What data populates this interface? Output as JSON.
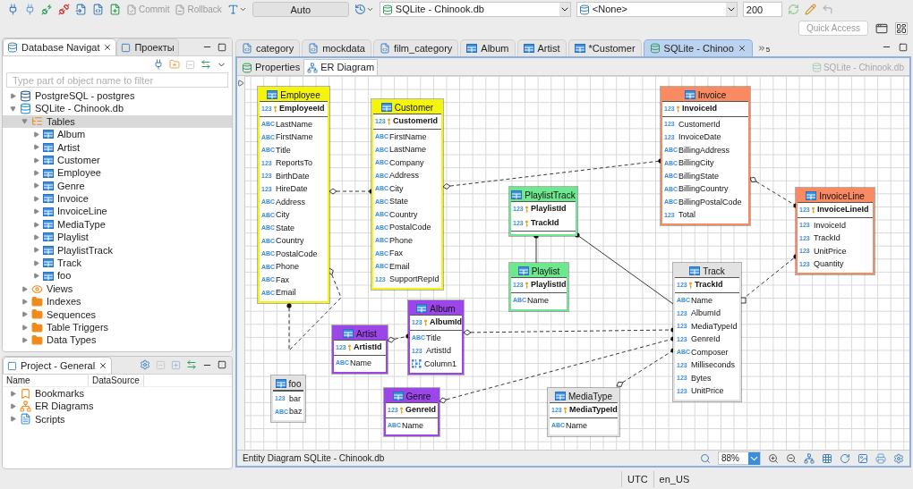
{
  "toolbar": {
    "commit": {
      "label": "Commit",
      "disabled": true
    },
    "rollback": {
      "label": "Rollback",
      "disabled": true
    },
    "transaction_mode": "Auto",
    "datasource": "SQLite - Chinook.db",
    "schema": "<None>",
    "result_limit": "200",
    "quick_access": {
      "placeholder": "Quick Access"
    }
  },
  "navigator": {
    "tabs": [
      {
        "label": "Database Navigat",
        "selected": true
      },
      {
        "label": "Проекты",
        "selected": false
      }
    ],
    "filter": {
      "placeholder": "Type part of object name to filter"
    },
    "tree": [
      {
        "label": "PostgreSQL - postgres",
        "kind": "postgres",
        "expanded": false,
        "selected": false
      },
      {
        "label": "SQLite - Chinook.db",
        "kind": "sqlite",
        "expanded": true,
        "selected": false,
        "children": [
          {
            "label": "Tables",
            "kind": "tables",
            "expanded": true,
            "selected": true,
            "children": [
              {
                "label": "Album",
                "kind": "table",
                "expanded": false,
                "selected": false
              },
              {
                "label": "Artist",
                "kind": "table",
                "expanded": false,
                "selected": false
              },
              {
                "label": "Customer",
                "kind": "table",
                "expanded": false,
                "selected": false
              },
              {
                "label": "Employee",
                "kind": "table",
                "expanded": false,
                "selected": false
              },
              {
                "label": "Genre",
                "kind": "table",
                "expanded": false,
                "selected": false
              },
              {
                "label": "Invoice",
                "kind": "table",
                "expanded": false,
                "selected": false
              },
              {
                "label": "InvoiceLine",
                "kind": "table",
                "expanded": false,
                "selected": false
              },
              {
                "label": "MediaType",
                "kind": "table",
                "expanded": false,
                "selected": false
              },
              {
                "label": "Playlist",
                "kind": "table",
                "expanded": false,
                "selected": false
              },
              {
                "label": "PlaylistTrack",
                "kind": "table",
                "expanded": false,
                "selected": false
              },
              {
                "label": "Track",
                "kind": "table",
                "expanded": false,
                "selected": false
              },
              {
                "label": "foo",
                "kind": "table",
                "expanded": false,
                "selected": false
              }
            ]
          },
          {
            "label": "Views",
            "kind": "views",
            "expanded": false,
            "selected": false
          },
          {
            "label": "Indexes",
            "kind": "folder",
            "expanded": false,
            "selected": false
          },
          {
            "label": "Sequences",
            "kind": "folder",
            "expanded": false,
            "selected": false
          },
          {
            "label": "Table Triggers",
            "kind": "folder",
            "expanded": false,
            "selected": false
          },
          {
            "label": "Data Types",
            "kind": "folder",
            "expanded": false,
            "selected": false
          }
        ]
      }
    ]
  },
  "project": {
    "title": "Project - General",
    "columns": [
      "Name",
      "DataSource"
    ],
    "items": [
      {
        "label": "Bookmarks",
        "kind": "bookmarks",
        "expanded": false
      },
      {
        "label": "ER Diagrams",
        "kind": "diagrams",
        "expanded": false
      },
      {
        "label": "Scripts",
        "kind": "scripts",
        "expanded": false
      }
    ]
  },
  "editor_tabs": [
    {
      "label": "category",
      "kind": "script",
      "selected": false
    },
    {
      "label": "mockdata",
      "kind": "script",
      "selected": false
    },
    {
      "label": "film_category",
      "kind": "script",
      "selected": false
    },
    {
      "label": "Album",
      "kind": "table",
      "selected": false
    },
    {
      "label": "Artist",
      "kind": "table",
      "selected": false
    },
    {
      "label": "*Customer",
      "kind": "table",
      "selected": false
    },
    {
      "label": "SQLite - Chinoo",
      "kind": "diagram",
      "selected": true
    }
  ],
  "hidden_tab_count": "5",
  "sub_tabs": [
    {
      "label": "Properties",
      "kind": "properties",
      "selected": false
    },
    {
      "label": "ER Diagram",
      "kind": "diagram",
      "selected": true
    }
  ],
  "object_label": "SQLite - Chinook.db",
  "diagram": {
    "entities": [
      {
        "name": "Employee",
        "color": "#f4f40c",
        "keys": [
          {
            "type": "123",
            "name": "EmployeeId"
          }
        ],
        "columns": [
          {
            "kind": "typed",
            "type": "ABC",
            "name": "LastName"
          },
          {
            "kind": "typed",
            "type": "ABC",
            "name": "FirstName"
          },
          {
            "kind": "typed",
            "type": "ABC",
            "name": "Title"
          },
          {
            "kind": "typed",
            "type": "123",
            "name": "ReportsTo"
          },
          {
            "kind": "typed",
            "type": "123",
            "name": "BirthDate"
          },
          {
            "kind": "typed",
            "type": "123",
            "name": "HireDate"
          },
          {
            "kind": "typed",
            "type": "ABC",
            "name": "Address"
          },
          {
            "kind": "typed",
            "type": "ABC",
            "name": "City"
          },
          {
            "kind": "typed",
            "type": "ABC",
            "name": "State"
          },
          {
            "kind": "typed",
            "type": "ABC",
            "name": "Country"
          },
          {
            "kind": "typed",
            "type": "ABC",
            "name": "PostalCode"
          },
          {
            "kind": "typed",
            "type": "ABC",
            "name": "Phone"
          },
          {
            "kind": "typed",
            "type": "ABC",
            "name": "Fax"
          },
          {
            "kind": "typed",
            "type": "ABC",
            "name": "Email"
          }
        ]
      },
      {
        "name": "Customer",
        "color": "#f4f40c",
        "keys": [
          {
            "type": "123",
            "name": "CustomerId"
          }
        ],
        "columns": [
          {
            "kind": "typed",
            "type": "ABC",
            "name": "FirstName"
          },
          {
            "kind": "typed",
            "type": "ABC",
            "name": "LastName"
          },
          {
            "kind": "typed",
            "type": "ABC",
            "name": "Company"
          },
          {
            "kind": "typed",
            "type": "ABC",
            "name": "Address"
          },
          {
            "kind": "typed",
            "type": "ABC",
            "name": "City"
          },
          {
            "kind": "typed",
            "type": "ABC",
            "name": "State"
          },
          {
            "kind": "typed",
            "type": "ABC",
            "name": "Country"
          },
          {
            "kind": "typed",
            "type": "ABC",
            "name": "PostalCode"
          },
          {
            "kind": "typed",
            "type": "ABC",
            "name": "Phone"
          },
          {
            "kind": "typed",
            "type": "ABC",
            "name": "Fax"
          },
          {
            "kind": "typed",
            "type": "ABC",
            "name": "Email"
          },
          {
            "kind": "typed",
            "type": "123",
            "name": "SupportRepId"
          }
        ]
      },
      {
        "name": "Invoice",
        "color": "#f98a62",
        "keys": [
          {
            "type": "123",
            "name": "InvoiceId"
          }
        ],
        "columns": [
          {
            "kind": "typed",
            "type": "123",
            "name": "CustomerId"
          },
          {
            "kind": "typed",
            "type": "123",
            "name": "InvoiceDate"
          },
          {
            "kind": "typed",
            "type": "ABC",
            "name": "BillingAddress"
          },
          {
            "kind": "typed",
            "type": "ABC",
            "name": "BillingCity"
          },
          {
            "kind": "typed",
            "type": "ABC",
            "name": "BillingState"
          },
          {
            "kind": "typed",
            "type": "ABC",
            "name": "BillingCountry"
          },
          {
            "kind": "typed",
            "type": "ABC",
            "name": "BillingPostalCode"
          },
          {
            "kind": "typed",
            "type": "123",
            "name": "Total"
          }
        ]
      },
      {
        "name": "PlaylistTrack",
        "color": "#6ee88e",
        "keys": [
          {
            "type": "123",
            "name": "PlaylistId"
          },
          {
            "type": "123",
            "name": "TrackId"
          }
        ]
      },
      {
        "name": "InvoiceLine",
        "color": "#f98a62",
        "keys": [
          {
            "type": "123",
            "name": "InvoiceLineId"
          }
        ],
        "columns": [
          {
            "kind": "typed",
            "type": "123",
            "name": "InvoiceId"
          },
          {
            "kind": "typed",
            "type": "123",
            "name": "TrackId"
          },
          {
            "kind": "typed",
            "type": "123",
            "name": "UnitPrice"
          },
          {
            "kind": "typed",
            "type": "123",
            "name": "Quantity"
          }
        ]
      },
      {
        "name": "Playlist",
        "color": "#6ee88e",
        "keys": [
          {
            "type": "123",
            "name": "PlaylistId"
          }
        ],
        "columns": [
          {
            "kind": "typed",
            "type": "ABC",
            "name": "Name"
          }
        ]
      },
      {
        "name": "Track",
        "color": "#e2e2e2",
        "keys": [
          {
            "type": "123",
            "name": "TrackId"
          }
        ],
        "columns": [
          {
            "kind": "typed",
            "type": "ABC",
            "name": "Name"
          },
          {
            "kind": "typed",
            "type": "123",
            "name": "AlbumId"
          },
          {
            "kind": "typed",
            "type": "123",
            "name": "MediaTypeId"
          },
          {
            "kind": "typed",
            "type": "123",
            "name": "GenreId"
          },
          {
            "kind": "typed",
            "type": "ABC",
            "name": "Composer"
          },
          {
            "kind": "typed",
            "type": "123",
            "name": "Milliseconds"
          },
          {
            "kind": "typed",
            "type": "123",
            "name": "Bytes"
          },
          {
            "kind": "typed",
            "type": "123",
            "name": "UnitPrice"
          }
        ]
      },
      {
        "name": "Artist",
        "color": "#9c45e8",
        "keys": [
          {
            "type": "123",
            "name": "ArtistId"
          }
        ],
        "columns": [
          {
            "kind": "typed",
            "type": "ABC",
            "name": "Name"
          }
        ]
      },
      {
        "name": "Album",
        "color": "#9c45e8",
        "keys": [
          {
            "type": "123",
            "name": "AlbumId"
          }
        ],
        "columns": [
          {
            "kind": "typed",
            "type": "ABC",
            "name": "Title"
          },
          {
            "kind": "typed",
            "type": "123",
            "name": "ArtistId"
          },
          {
            "kind": "binary",
            "name": "Column1"
          }
        ]
      },
      {
        "name": "foo",
        "color": "#e2e2e2",
        "columns": [
          {
            "kind": "typed",
            "type": "123",
            "name": "bar"
          },
          {
            "kind": "typed",
            "type": "ABC",
            "name": "baz"
          }
        ]
      },
      {
        "name": "Genre",
        "color": "#9c45e8",
        "keys": [
          {
            "type": "123",
            "name": "GenreId"
          }
        ],
        "columns": [
          {
            "kind": "typed",
            "type": "ABC",
            "name": "Name"
          }
        ]
      },
      {
        "name": "MediaType",
        "color": "#e2e2e2",
        "keys": [
          {
            "type": "123",
            "name": "MediaTypeId"
          }
        ],
        "columns": [
          {
            "kind": "typed",
            "type": "ABC",
            "name": "Name"
          }
        ]
      }
    ],
    "footer_title": "Entity Diagram SQLite - Chinook.db",
    "zoom": "88%"
  },
  "status_bar": [
    "UTC",
    "en_US"
  ]
}
